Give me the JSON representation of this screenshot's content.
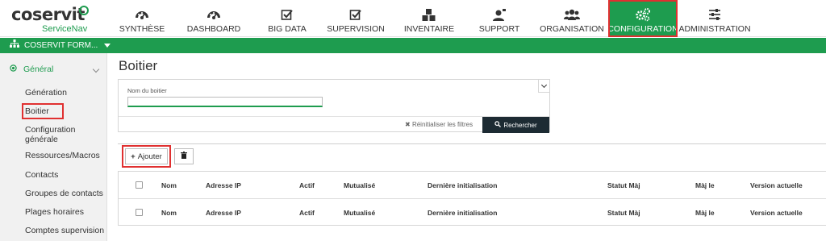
{
  "logo": {
    "name": "coservit",
    "sub": "ServiceNav"
  },
  "nav": [
    {
      "label": "SYNTHÈSE",
      "icon": "gauge-icon"
    },
    {
      "label": "DASHBOARD",
      "icon": "gauge-icon"
    },
    {
      "label": "BIG DATA",
      "icon": "check-square-icon"
    },
    {
      "label": "SUPERVISION",
      "icon": "check-square-icon"
    },
    {
      "label": "INVENTAIRE",
      "icon": "cubes-icon"
    },
    {
      "label": "SUPPORT",
      "icon": "user-support-icon"
    },
    {
      "label": "ORGANISATION",
      "icon": "users-icon"
    },
    {
      "label": "CONFIGURATION",
      "icon": "gears-icon",
      "active": true
    },
    {
      "label": "ADMINISTRATION",
      "icon": "sliders-icon"
    }
  ],
  "org": {
    "label": "COSERVIT FORM..."
  },
  "sidebar": {
    "section": "Général",
    "items": [
      "Génération",
      "Boitier",
      "Configuration générale",
      "Ressources/Macros",
      "Contacts",
      "Groupes de contacts",
      "Plages horaires",
      "Comptes supervision"
    ],
    "config_line1": "Configuration",
    "config_line2": "générale"
  },
  "page": {
    "title": "Boitier"
  },
  "filter": {
    "label": "Nom du boitier",
    "value": "",
    "reset": "Réinitialiser les filtres",
    "search": "Rechercher"
  },
  "toolbar": {
    "add": "Ajouter"
  },
  "table": {
    "columns": [
      "Nom",
      "Adresse IP",
      "Actif",
      "Mutualisé",
      "Dernière initialisation",
      "Statut Màj",
      "Màj le",
      "Version actuelle"
    ],
    "rows": [
      [
        "Nom",
        "Adresse IP",
        "Actif",
        "Mutualisé",
        "Dernière initialisation",
        "Statut Màj",
        "Màj le",
        "Version actuelle"
      ]
    ]
  },
  "colors": {
    "accent": "#1e9c4f",
    "highlight": "#e03030",
    "dark_button": "#1d2b33"
  }
}
